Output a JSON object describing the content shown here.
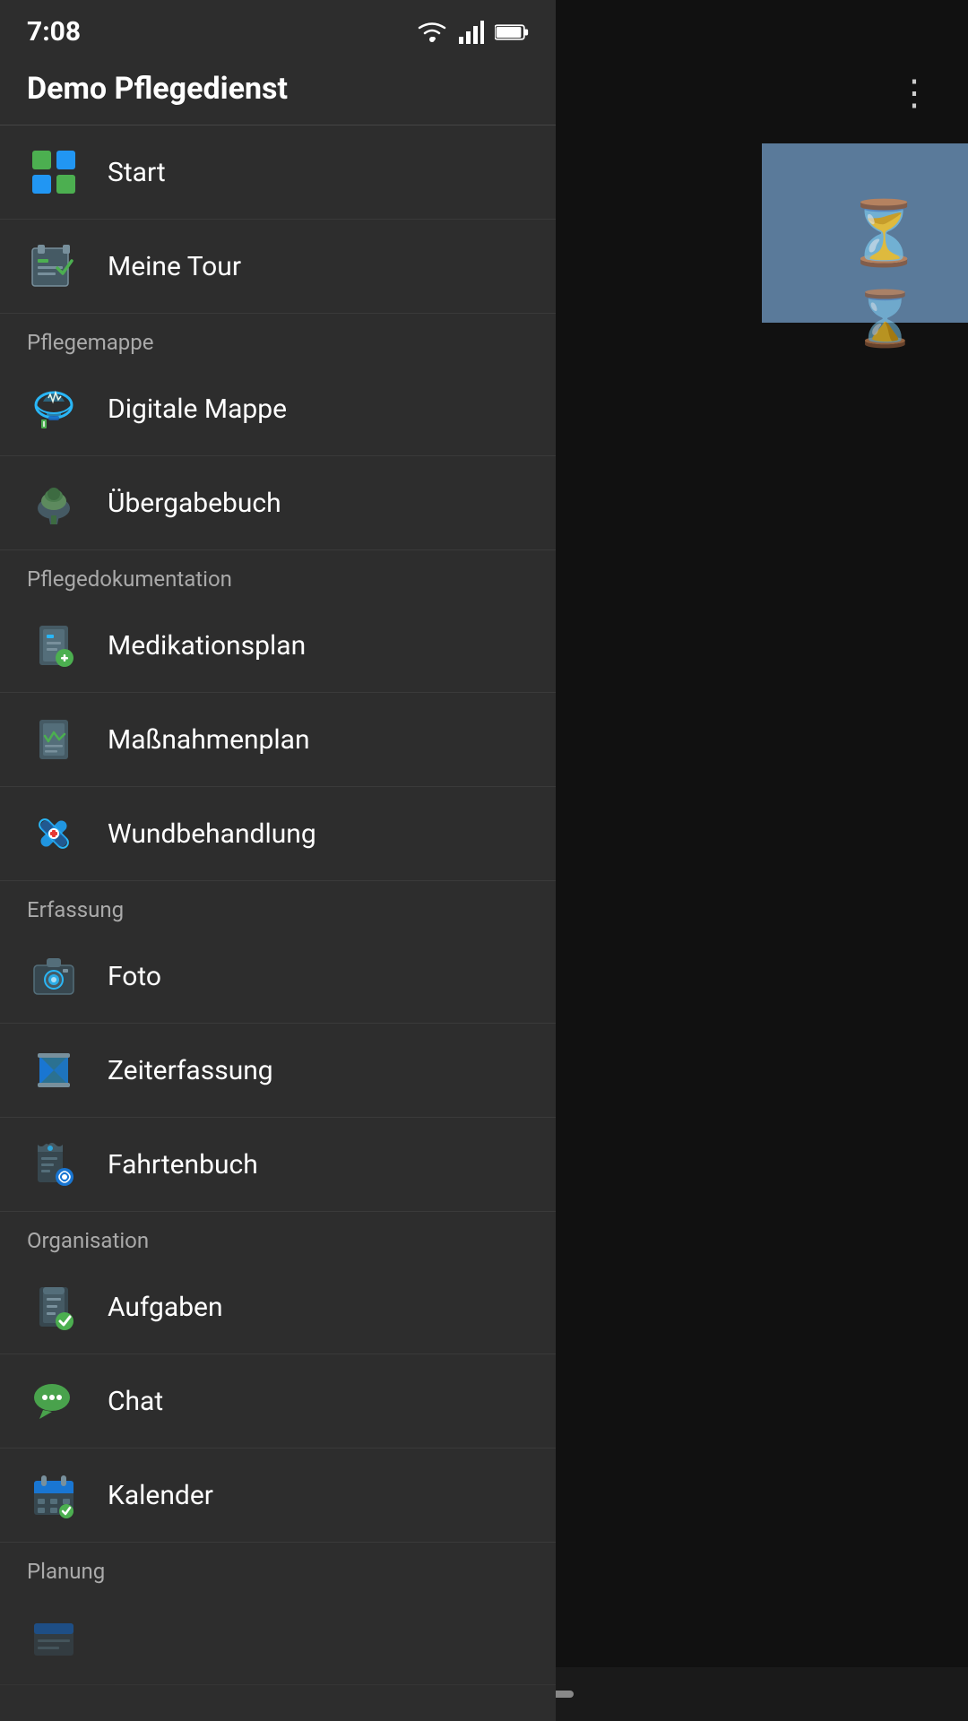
{
  "app": {
    "title": "Demo Pflegedienst"
  },
  "status_bar": {
    "time": "7:08"
  },
  "more_menu_icon": "⋮",
  "sections": [
    {
      "id": "top",
      "header": null,
      "items": [
        {
          "id": "start",
          "label": "Start",
          "icon": "grid"
        },
        {
          "id": "meine-tour",
          "label": "Meine Tour",
          "icon": "tour"
        }
      ]
    },
    {
      "id": "pflegemappe",
      "header": "Pflegemappe",
      "items": [
        {
          "id": "digitale-mappe",
          "label": "Digitale Mappe",
          "icon": "cloud"
        },
        {
          "id": "ubergabebuch",
          "label": "Übergabebuch",
          "icon": "book"
        }
      ]
    },
    {
      "id": "pflegedokumentation",
      "header": "Pflegedokumentation",
      "items": [
        {
          "id": "medikationsplan",
          "label": "Medikationsplan",
          "icon": "meds"
        },
        {
          "id": "massnahmenplan",
          "label": "Maßnahmenplan",
          "icon": "plan"
        },
        {
          "id": "wundbehandlung",
          "label": "Wundbehandlung",
          "icon": "bandaid"
        }
      ]
    },
    {
      "id": "erfassung",
      "header": "Erfassung",
      "items": [
        {
          "id": "foto",
          "label": "Foto",
          "icon": "camera"
        },
        {
          "id": "zeiterfassung",
          "label": "Zeiterfassung",
          "icon": "hourglass"
        },
        {
          "id": "fahrtenbuch",
          "label": "Fahrtenbuch",
          "icon": "route"
        }
      ]
    },
    {
      "id": "organisation",
      "header": "Organisation",
      "items": [
        {
          "id": "aufgaben",
          "label": "Aufgaben",
          "icon": "tasks"
        },
        {
          "id": "chat",
          "label": "Chat",
          "icon": "chat"
        },
        {
          "id": "kalender",
          "label": "Kalender",
          "icon": "calendar"
        }
      ]
    },
    {
      "id": "planung",
      "header": "Planung",
      "items": []
    }
  ]
}
